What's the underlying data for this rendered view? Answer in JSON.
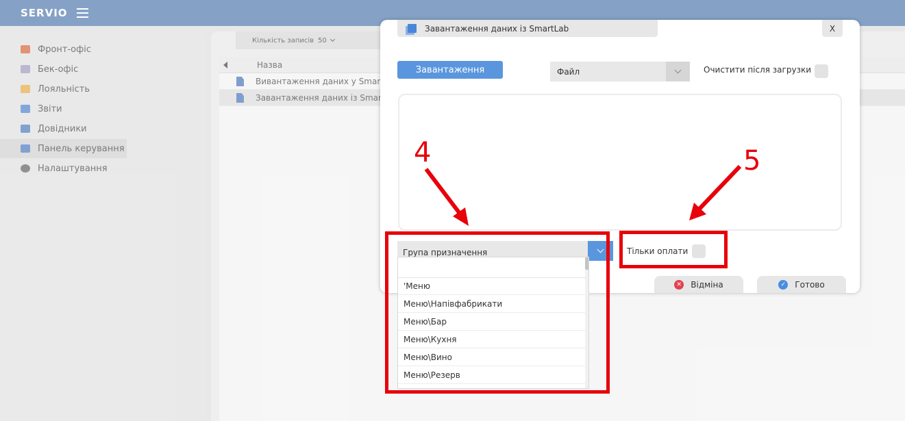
{
  "app": {
    "logo": "SERVIO"
  },
  "sidebar": {
    "items": [
      {
        "label": "Фронт-офіс",
        "icon": "briefcase-icon",
        "color": "#d45a2a"
      },
      {
        "label": "Бек-офіс",
        "icon": "stack-icon",
        "color": "#9a8fb8"
      },
      {
        "label": "Лояльність",
        "icon": "people-icon",
        "color": "#e2a13a"
      },
      {
        "label": "Звіти",
        "icon": "report-icon",
        "color": "#3e78c8"
      },
      {
        "label": "Довідники",
        "icon": "book-icon",
        "color": "#3e6fb8"
      },
      {
        "label": "Панель керування",
        "icon": "panel-icon",
        "color": "#3e6fb8"
      },
      {
        "label": "Налаштування",
        "icon": "gear-icon",
        "color": "#555555"
      }
    ],
    "active_index": 5
  },
  "main": {
    "records_label": "Кількість записів",
    "records_value": "50",
    "column_name": "Назва",
    "rows": [
      "Вивантаження даних у SmartLab",
      "Завантаження даних із SmartLab"
    ]
  },
  "dialog": {
    "title": "Завантаження даних із SmartLab",
    "close_label": "X",
    "upload_button": "Завантаження",
    "file_select_value": "Файл",
    "clear_after_label": "Очистити після загрузки",
    "group_select_value": "Група призначення",
    "only_payments_label": "Тільки оплати",
    "cancel_button": "Відміна",
    "done_button": "Готово",
    "dropdown_options": [
      "'Меню",
      "Меню\\Напівфабрикати",
      "Меню\\Бар",
      "Меню\\Кухня",
      "Меню\\Вино",
      "Меню\\Резерв"
    ]
  },
  "annotations": {
    "label_4": "4",
    "label_5": "5",
    "color": "#e8000a"
  }
}
